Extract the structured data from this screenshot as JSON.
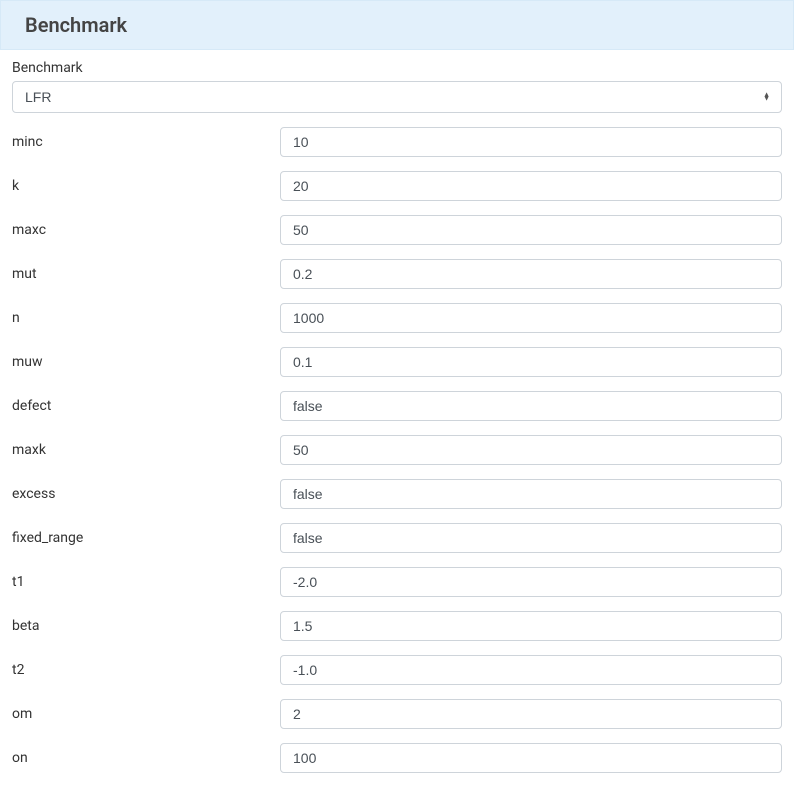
{
  "header": {
    "title": "Benchmark"
  },
  "select": {
    "label": "Benchmark",
    "value": "LFR"
  },
  "fields": [
    {
      "label": "minc",
      "value": "10"
    },
    {
      "label": "k",
      "value": "20"
    },
    {
      "label": "maxc",
      "value": "50"
    },
    {
      "label": "mut",
      "value": "0.2"
    },
    {
      "label": "n",
      "value": "1000"
    },
    {
      "label": "muw",
      "value": "0.1"
    },
    {
      "label": "defect",
      "value": "false"
    },
    {
      "label": "maxk",
      "value": "50"
    },
    {
      "label": "excess",
      "value": "false"
    },
    {
      "label": "fixed_range",
      "value": "false"
    },
    {
      "label": "t1",
      "value": "-2.0"
    },
    {
      "label": "beta",
      "value": "1.5"
    },
    {
      "label": "t2",
      "value": "-1.0"
    },
    {
      "label": "om",
      "value": "2"
    },
    {
      "label": "on",
      "value": "100"
    }
  ]
}
